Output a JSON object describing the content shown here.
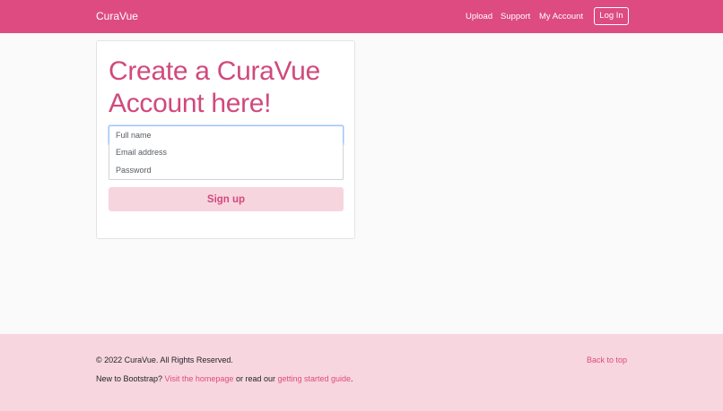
{
  "navbar": {
    "brand": "CuraVue",
    "links": [
      "Upload",
      "Support",
      "My Account"
    ],
    "login_label": "Log In"
  },
  "form": {
    "heading": "Create a CuraVue Account here!",
    "full_name_placeholder": "Full name",
    "email_placeholder": "Email address",
    "password_placeholder": "Password",
    "submit_label": "Sign up"
  },
  "footer": {
    "copyright": "© 2022 CuraVue. All Rights Reserved.",
    "back_to_top": "Back to top",
    "prefix": "New to Bootstrap? ",
    "homepage_link": "Visit the homepage",
    "middle": " or read our ",
    "guide_link": "getting started guide",
    "suffix": "."
  },
  "colors": {
    "brand": "#dd4b80",
    "heading": "#d1497c",
    "footer_bg": "#f8d6df",
    "button_bg": "#f7d5df"
  }
}
